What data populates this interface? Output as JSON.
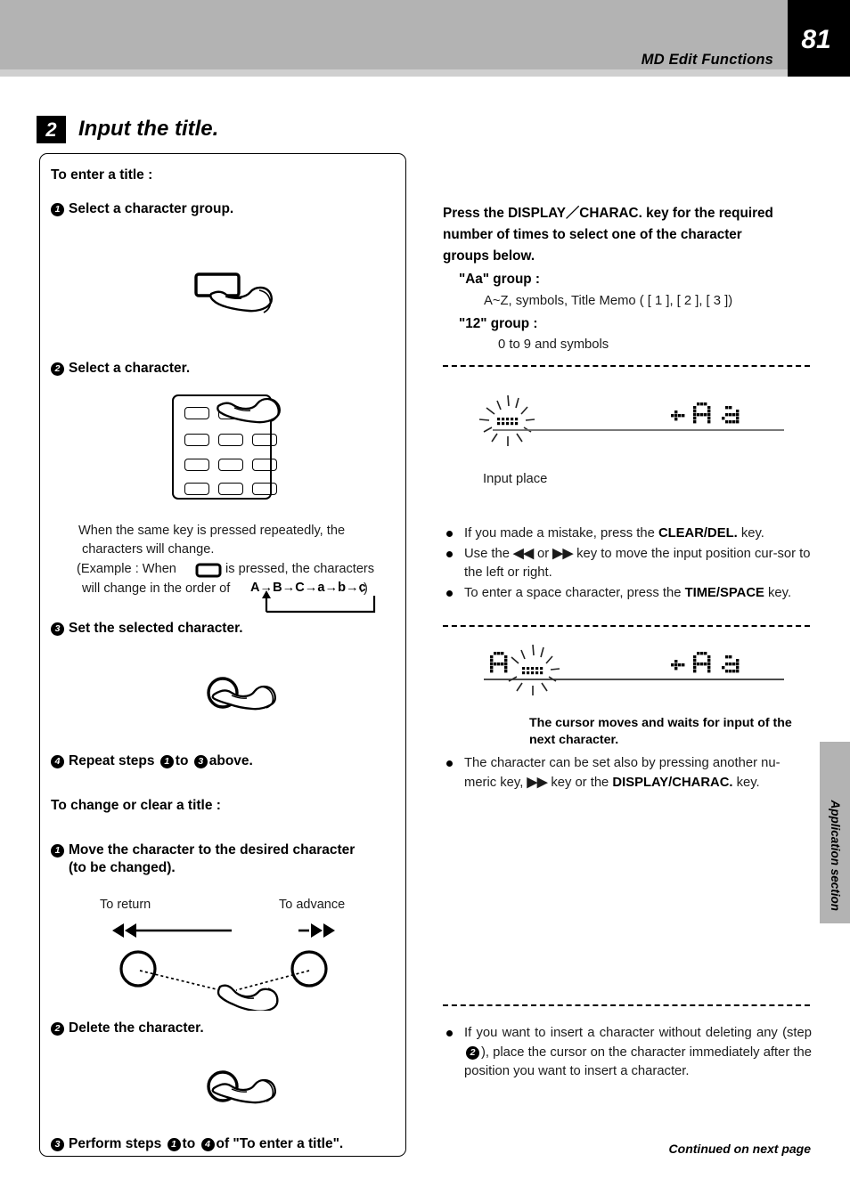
{
  "header": {
    "page_number": "81",
    "section_title": "MD Edit Functions",
    "side_tab": "Application section"
  },
  "step": {
    "badge": "2",
    "title": "Input the title."
  },
  "left": {
    "heading_enter": "To enter a title :",
    "s1_num": "1",
    "s1_label": "Select a character group.",
    "s2_num": "2",
    "s2_label": "Select a character.",
    "note_line1": "When the same key is pressed repeatedly, the",
    "note_line2": "characters will change.",
    "note_line3a": "(Example : When",
    "note_line3b": "is pressed, the characters",
    "note_line4a": "will change in the order of",
    "note_sequence": "A→B→C→a→b→c",
    "note_line4b": ".)",
    "s3_num": "3",
    "s3_label": "Set the selected character.",
    "s4_num": "4",
    "s4_label_a": "Repeat steps",
    "s4_ref1": "1",
    "s4_label_b": "to",
    "s4_ref2": "3",
    "s4_label_c": "above.",
    "heading_change": "To change or clear a title :",
    "c1_num": "1",
    "c1_label_line1": "Move the character to the desired character",
    "c1_label_line2": "(to be changed).",
    "to_return": "To return",
    "to_advance": "To advance",
    "rew_icon": "rewind-icon",
    "ffwd_icon": "fast-forward-icon",
    "c2_num": "2",
    "c2_label": "Delete the character.",
    "c3_num": "3",
    "c3_label_a": "Perform steps",
    "c3_ref1": "1",
    "c3_label_b": "to",
    "c3_ref2": "4",
    "c3_label_c": "of \"To enter a title\"."
  },
  "right": {
    "intro_line1": "Press the DISPLAY／CHARAC. key for the required",
    "intro_line2": "number of times to select one of the character",
    "intro_line3": "groups below.",
    "group_aa_label": "\"Aa\" group :",
    "group_aa_desc": "A~Z, symbols, Title Memo ( [ 1 ], [ 2 ], [ 3 ])",
    "group_12_label": "\"12\" group :",
    "group_12_desc": "0 to 9 and symbols",
    "display1_caption": "Input place",
    "display1_indicator": "Aa",
    "display2_indicator": "Aa",
    "display2_char": "A",
    "display2_caption_line1": "The cursor moves and waits for input of the",
    "display2_caption_line2": "next character.",
    "bullets_1": [
      {
        "pre": "If you made a mistake, press the ",
        "kw": "CLEAR/DEL.",
        "post": " key."
      },
      {
        "pre": "Use the ◄◄ or ►► key to move the input position cur-sor to the left or right.",
        "kw": "",
        "post": ""
      },
      {
        "pre": "To enter a space character, press the ",
        "kw": "TIME/SPACE",
        "post": " key."
      }
    ],
    "bullet_2_pre": "The character can be set also by pressing another nu-meric key, ►► key or the ",
    "bullet_2_kw": "DISPLAY/CHARAC.",
    "bullet_2_post": " key.",
    "bullet_3_a": "If you want to insert a character without deleting any (step ",
    "bullet_3_ref": "2",
    "bullet_3_b": "), place the cursor on the character immediately after the position you want to insert a character.",
    "continued": "Continued on next page"
  },
  "colors": {
    "header_band": "#b3b3b3",
    "page_num_bg": "#000000",
    "text": "#000000"
  }
}
